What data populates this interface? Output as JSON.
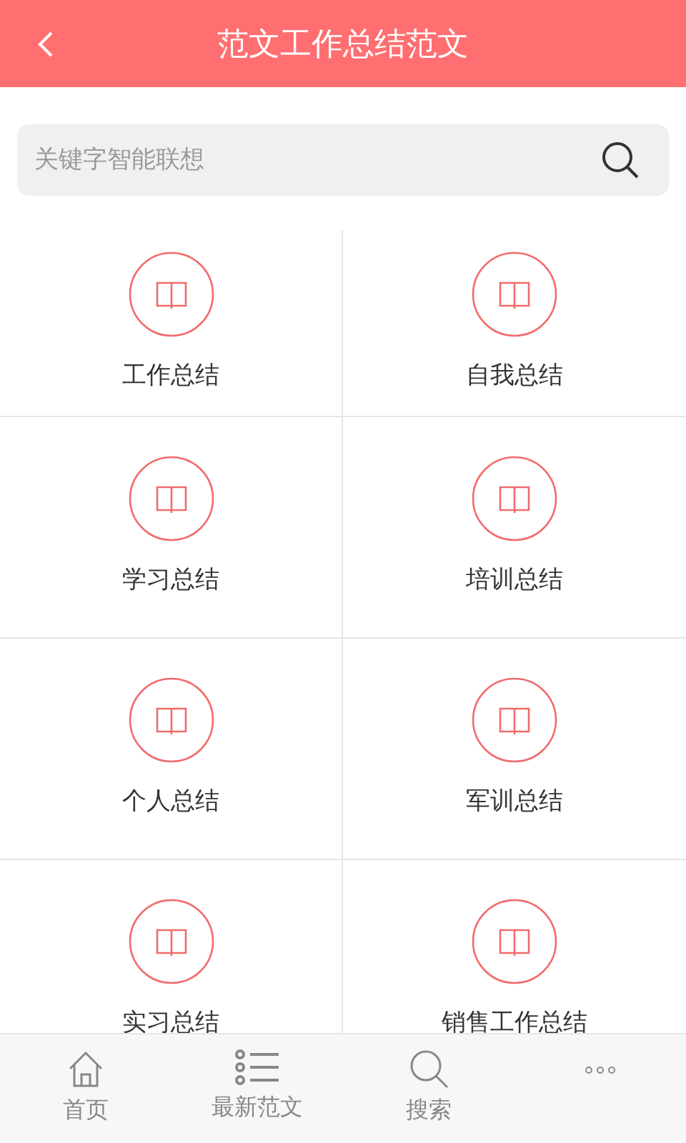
{
  "header": {
    "title": "范文工作总结范文"
  },
  "search": {
    "placeholder": "关键字智能联想"
  },
  "categories": [
    {
      "label": "工作总结"
    },
    {
      "label": "自我总结"
    },
    {
      "label": "学习总结"
    },
    {
      "label": "培训总结"
    },
    {
      "label": "个人总结"
    },
    {
      "label": "军训总结"
    },
    {
      "label": "实习总结"
    },
    {
      "label": "销售工作总结"
    }
  ],
  "nav": [
    {
      "kind": "home",
      "label": "首页"
    },
    {
      "kind": "list",
      "label": "最新范文"
    },
    {
      "kind": "search",
      "label": "搜索"
    },
    {
      "kind": "more"
    }
  ]
}
